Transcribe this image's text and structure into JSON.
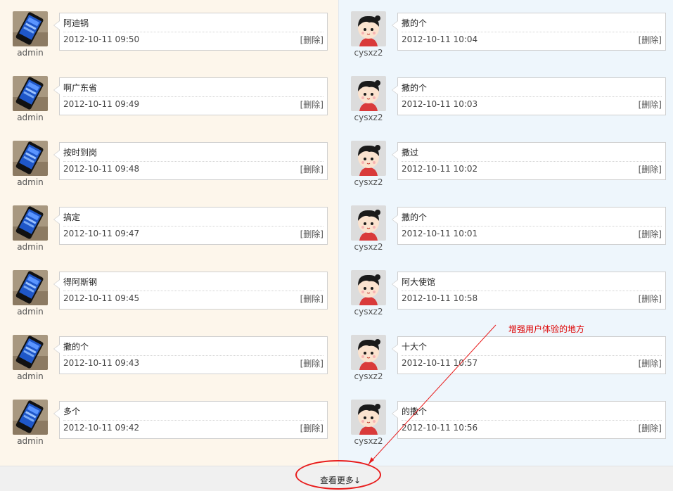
{
  "left": [
    {
      "user": "admin",
      "message": "阿迪锅",
      "time": "2012-10-11 09:50",
      "delete": "[删除]"
    },
    {
      "user": "admin",
      "message": "啊广东省",
      "time": "2012-10-11 09:49",
      "delete": "[删除]"
    },
    {
      "user": "admin",
      "message": "按时到岗",
      "time": "2012-10-11 09:48",
      "delete": "[删除]"
    },
    {
      "user": "admin",
      "message": "搞定",
      "time": "2012-10-11 09:47",
      "delete": "[删除]"
    },
    {
      "user": "admin",
      "message": "得阿斯钢",
      "time": "2012-10-11 09:45",
      "delete": "[删除]"
    },
    {
      "user": "admin",
      "message": "撒的个",
      "time": "2012-10-11 09:43",
      "delete": "[删除]"
    },
    {
      "user": "admin",
      "message": "多个",
      "time": "2012-10-11 09:42",
      "delete": "[删除]"
    }
  ],
  "right": [
    {
      "user": "cysxz2",
      "message": "撒的个",
      "time": "2012-10-11 10:04",
      "delete": "[删除]"
    },
    {
      "user": "cysxz2",
      "message": "撒的个",
      "time": "2012-10-11 10:03",
      "delete": "[删除]"
    },
    {
      "user": "cysxz2",
      "message": "撒过",
      "time": "2012-10-11 10:02",
      "delete": "[删除]"
    },
    {
      "user": "cysxz2",
      "message": "撒的个",
      "time": "2012-10-11 10:01",
      "delete": "[删除]"
    },
    {
      "user": "cysxz2",
      "message": "阿大使馆",
      "time": "2012-10-11 10:58",
      "delete": "[删除]"
    },
    {
      "user": "cysxz2",
      "message": "十大个",
      "time": "2012-10-11 10:57",
      "delete": "[删除]"
    },
    {
      "user": "cysxz2",
      "message": "的撒个",
      "time": "2012-10-11 10:56",
      "delete": "[删除]"
    }
  ],
  "footer": {
    "more_label": "查看更多↓"
  },
  "annotation": {
    "text": "增强用户体验的地方",
    "color": "#e81c1c"
  },
  "icons": {
    "admin_avatar": "phone-avatar-icon",
    "cysxz2_avatar": "cartoon-girl-avatar-icon"
  }
}
